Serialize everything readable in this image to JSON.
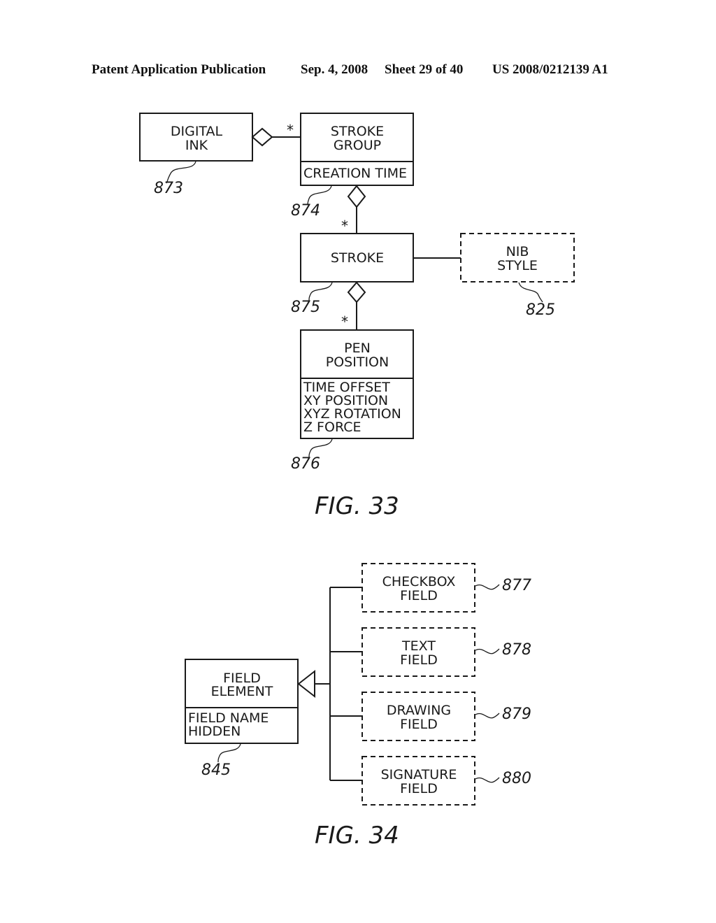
{
  "header": {
    "publication": "Patent Application Publication",
    "date": "Sep. 4, 2008",
    "sheet": "Sheet 29 of 40",
    "number": "US 2008/0212139 A1"
  },
  "fig33": {
    "caption": "FIG. 33",
    "multiplicity": "*",
    "digital_ink": {
      "lines": [
        "DIGITAL",
        "INK"
      ],
      "ref": "873"
    },
    "stroke_group": {
      "lines": [
        "STROKE",
        "GROUP"
      ],
      "attributes": [
        "CREATION TIME"
      ],
      "ref": "874"
    },
    "stroke": {
      "lines": [
        "STROKE"
      ],
      "ref": "875"
    },
    "nib_style": {
      "lines": [
        "NIB",
        "STYLE"
      ],
      "ref": "825"
    },
    "pen_position": {
      "lines": [
        "PEN",
        "POSITION"
      ],
      "attributes": [
        "TIME OFFSET",
        "XY POSITION",
        "XYZ ROTATION",
        "Z FORCE"
      ],
      "ref": "876"
    }
  },
  "fig34": {
    "caption": "FIG. 34",
    "field_element": {
      "lines": [
        "FIELD",
        "ELEMENT"
      ],
      "attributes": [
        "FIELD NAME",
        "HIDDEN"
      ],
      "ref": "845"
    },
    "subclasses": [
      {
        "lines": [
          "CHECKBOX",
          "FIELD"
        ],
        "ref": "877"
      },
      {
        "lines": [
          "TEXT",
          "FIELD"
        ],
        "ref": "878"
      },
      {
        "lines": [
          "DRAWING",
          "FIELD"
        ],
        "ref": "879"
      },
      {
        "lines": [
          "SIGNATURE",
          "FIELD"
        ],
        "ref": "880"
      }
    ]
  }
}
